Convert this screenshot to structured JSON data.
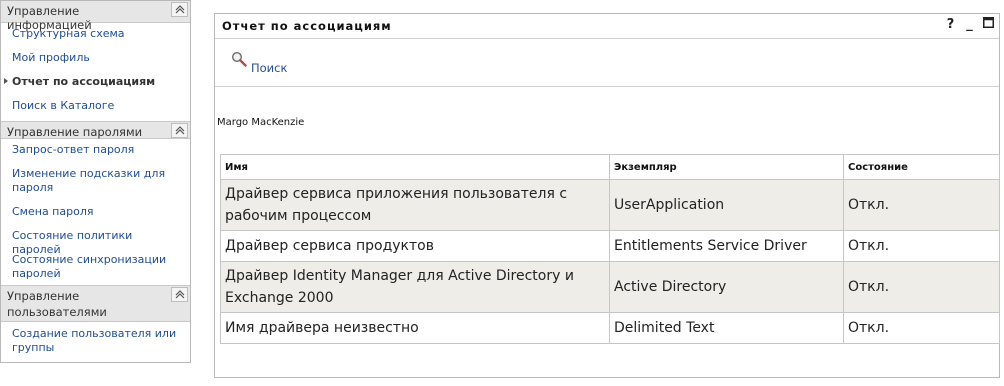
{
  "sidebar": {
    "sections": [
      {
        "title": "Управление информацией",
        "items": [
          {
            "label": "Структурная схема"
          },
          {
            "label": "Мой профиль"
          },
          {
            "label": "Отчет по ассоциациям"
          },
          {
            "label": "Поиск в Каталоге"
          }
        ]
      },
      {
        "title": "Управление паролями",
        "items": [
          {
            "label": "Запрос-ответ пароля"
          },
          {
            "label": "Изменение подсказки для пароля"
          },
          {
            "label": "Смена пароля"
          },
          {
            "label": "Состояние политики паролей"
          },
          {
            "label": "Состояние синхронизации паролей"
          }
        ]
      },
      {
        "title": "Управление пользователями",
        "items": [
          {
            "label": "Создание пользователя или группы"
          }
        ]
      }
    ]
  },
  "panel": {
    "title": "Отчет по ассоциациям",
    "controls": {
      "help": "?",
      "minimize": "_",
      "maximize": "□"
    },
    "search_label": "Поиск",
    "user_name": "Margo MacKenzie"
  },
  "table": {
    "headers": [
      "Имя",
      "Экземпляр",
      "Состояние"
    ],
    "rows": [
      [
        "Драйвер сервиса приложения пользователя с рабочим процессом",
        "UserApplication",
        "Откл."
      ],
      [
        "Драйвер сервиса продуктов",
        "Entitlements Service Driver",
        "Откл."
      ],
      [
        "Драйвер Identity Manager для Active Directory и Exchange 2000",
        "Active Directory",
        "Откл."
      ],
      [
        "Имя драйвера неизвестно",
        "Delimited Text",
        "Откл."
      ]
    ]
  }
}
